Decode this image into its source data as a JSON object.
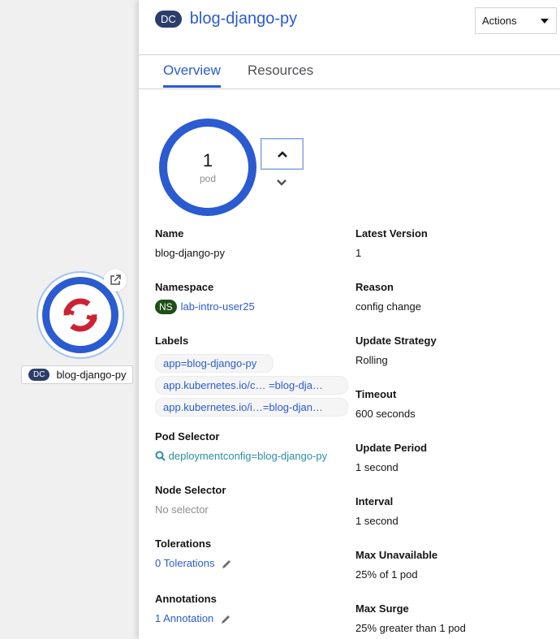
{
  "topology": {
    "node_kind": "DC",
    "node_name": "blog-django-py",
    "external_link_icon": "external-link-icon",
    "logo_icon": "openshift-logo-icon"
  },
  "panel": {
    "header": {
      "kind": "DC",
      "title": "blog-django-py"
    },
    "actions_label": "Actions",
    "tabs": [
      {
        "label": "Overview",
        "active": true
      },
      {
        "label": "Resources",
        "active": false
      }
    ],
    "pod_ring": {
      "count": "1",
      "unit": "pod"
    },
    "left_fields": {
      "name": {
        "label": "Name",
        "value": "blog-django-py"
      },
      "namespace": {
        "label": "Namespace",
        "badge": "NS",
        "value": "lab-intro-user25"
      },
      "labels": {
        "label": "Labels",
        "items": [
          "app=blog-django-py",
          "app.kubernetes.io/c… =blog-dja…",
          "app.kubernetes.io/i…=blog-djan…"
        ]
      },
      "pod_selector": {
        "label": "Pod Selector",
        "value": "deploymentconfig=blog-django-py"
      },
      "node_selector": {
        "label": "Node Selector",
        "value": "No selector"
      },
      "tolerations": {
        "label": "Tolerations",
        "value": "0 Tolerations"
      },
      "annotations": {
        "label": "Annotations",
        "value": "1 Annotation"
      }
    },
    "right_fields": {
      "latest_version": {
        "label": "Latest Version",
        "value": "1"
      },
      "reason": {
        "label": "Reason",
        "value": "config change"
      },
      "update_strategy": {
        "label": "Update Strategy",
        "value": "Rolling"
      },
      "timeout": {
        "label": "Timeout",
        "value": "600 seconds"
      },
      "update_period": {
        "label": "Update Period",
        "value": "1 second"
      },
      "interval": {
        "label": "Interval",
        "value": "1 second"
      },
      "max_unavailable": {
        "label": "Max Unavailable",
        "value": "25% of 1 pod"
      },
      "max_surge": {
        "label": "Max Surge",
        "value": "25% greater than 1 pod"
      }
    }
  },
  "colors": {
    "accent": "#2b5bd0",
    "dc_badge": "#2b3e6b",
    "ns_badge": "#1e4f18",
    "logo_red": "#cc2233"
  }
}
